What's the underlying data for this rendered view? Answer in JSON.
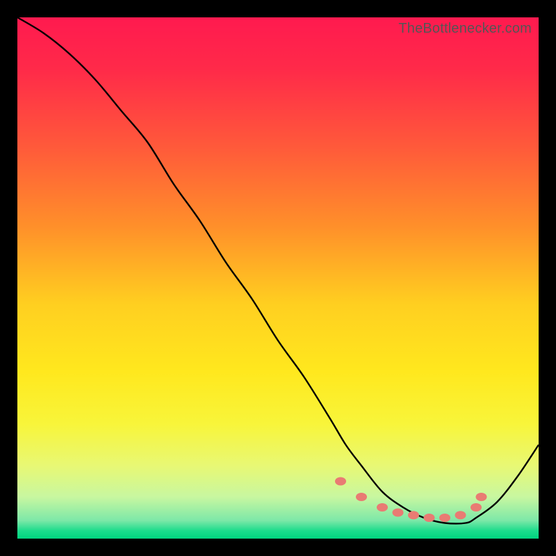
{
  "watermark": "TheBottlenecker.com",
  "gradient_stops": [
    {
      "offset": 0.0,
      "color": "#ff1a4f"
    },
    {
      "offset": 0.1,
      "color": "#ff2a49"
    },
    {
      "offset": 0.25,
      "color": "#ff5a3a"
    },
    {
      "offset": 0.4,
      "color": "#ff8f2a"
    },
    {
      "offset": 0.55,
      "color": "#ffcf20"
    },
    {
      "offset": 0.68,
      "color": "#ffe81e"
    },
    {
      "offset": 0.78,
      "color": "#f8f53a"
    },
    {
      "offset": 0.86,
      "color": "#e8f874"
    },
    {
      "offset": 0.92,
      "color": "#c8f7a0"
    },
    {
      "offset": 0.965,
      "color": "#7de8a8"
    },
    {
      "offset": 0.985,
      "color": "#1bdc8c"
    },
    {
      "offset": 1.0,
      "color": "#00d47f"
    }
  ],
  "chart_data": {
    "type": "line",
    "title": "",
    "xlabel": "",
    "ylabel": "",
    "xlim": [
      0,
      100
    ],
    "ylim": [
      0,
      100
    ],
    "series": [
      {
        "name": "bottleneck-curve",
        "x": [
          0,
          5,
          10,
          15,
          20,
          25,
          30,
          35,
          40,
          45,
          50,
          55,
          60,
          63,
          66,
          70,
          74,
          78,
          82,
          86,
          88,
          92,
          96,
          100
        ],
        "values": [
          100,
          97,
          93,
          88,
          82,
          76,
          68,
          61,
          53,
          46,
          38,
          31,
          23,
          18,
          14,
          9,
          6,
          4,
          3,
          3,
          4,
          7,
          12,
          18
        ]
      }
    ],
    "markers": {
      "name": "highlight-dots",
      "color": "#e97b73",
      "x": [
        62,
        66,
        70,
        73,
        76,
        79,
        82,
        85,
        88,
        89
      ],
      "values": [
        11,
        8,
        6,
        5,
        4.5,
        4,
        4,
        4.5,
        6,
        8
      ]
    }
  }
}
